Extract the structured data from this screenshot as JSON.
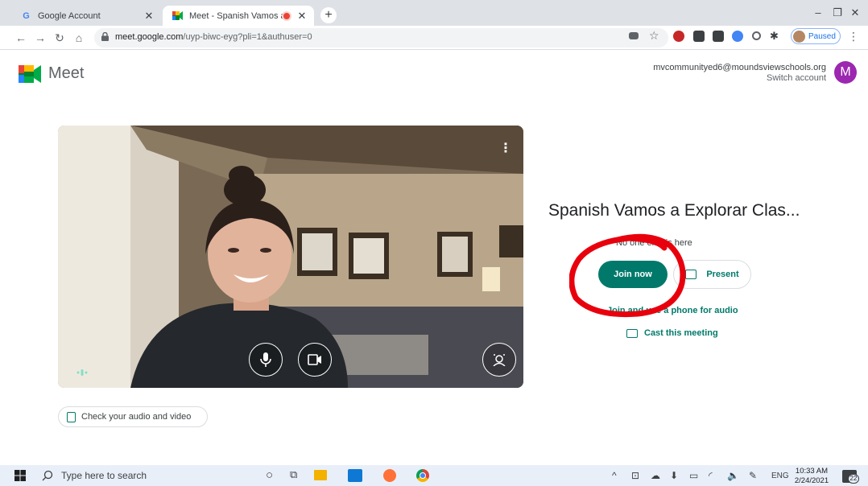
{
  "browser": {
    "tabs": [
      {
        "title": "Google Account",
        "icon": "google-g-icon",
        "active": false
      },
      {
        "title": "Meet - Spanish Vamos a Exp",
        "icon": "meet-icon",
        "active": true
      }
    ],
    "new_tab_label": "+",
    "url_host": "meet.google.com",
    "url_path": "/uyp-biwc-eyg?pli=1&authuser=0",
    "profile_status": "Paused"
  },
  "meet": {
    "brand": "Meet",
    "account_email": "mvcommunityed6@moundsviewschools.org",
    "switch_account": "Switch account",
    "avatar_letter": "M",
    "meeting_title": "Spanish Vamos a Explorar Clas...",
    "status_text": "No one else is here",
    "join_label": "Join now",
    "present_label": "Present",
    "phone_link": "Join and use a phone for audio",
    "cast_link": "Cast this meeting",
    "check_av_label": "Check your audio and video",
    "accent_color": "#00796b",
    "annotation_color": "#e8000d"
  },
  "taskbar": {
    "search_placeholder": "Type here to search",
    "language": "ENG",
    "time": "10:33 AM",
    "date": "2/24/2021",
    "notification_count": "22"
  }
}
